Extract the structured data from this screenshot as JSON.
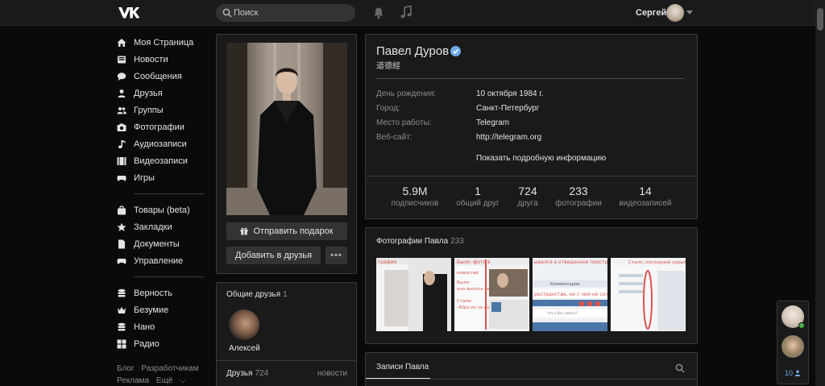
{
  "header": {
    "search_placeholder": "Поиск",
    "user_name": "Сергей"
  },
  "menu": {
    "group1": [
      {
        "label": "Моя Страница",
        "icon": "home-icon"
      },
      {
        "label": "Новости",
        "icon": "news-icon"
      },
      {
        "label": "Сообщения",
        "icon": "messages-icon"
      },
      {
        "label": "Друзья",
        "icon": "friends-icon"
      },
      {
        "label": "Группы",
        "icon": "groups-icon"
      },
      {
        "label": "Фотографии",
        "icon": "camera-icon"
      },
      {
        "label": "Аудиозаписи",
        "icon": "music-icon"
      },
      {
        "label": "Видеозаписи",
        "icon": "video-icon"
      },
      {
        "label": "Игры",
        "icon": "gamepad-icon"
      }
    ],
    "group2": [
      {
        "label": "Товары (beta)",
        "icon": "bag-icon"
      },
      {
        "label": "Закладки",
        "icon": "star-icon"
      },
      {
        "label": "Документы",
        "icon": "document-icon"
      },
      {
        "label": "Управление",
        "icon": "gamepad-icon"
      }
    ],
    "group3": [
      {
        "label": "Верность",
        "icon": "stack-icon"
      },
      {
        "label": "Безумие",
        "icon": "crown-icon"
      },
      {
        "label": "Нано",
        "icon": "stack-icon"
      },
      {
        "label": "Радио",
        "icon": "grid-icon"
      }
    ]
  },
  "footer": {
    "blog": "Блог",
    "developers": "Разработчикам",
    "ads": "Реклама",
    "more": "Ещё"
  },
  "profile": {
    "gift_button": "Отправить подарок",
    "add_friend_button": "Добавить в друзья",
    "name": "Павел Дуров",
    "status": "道德經",
    "fields": [
      {
        "key": "День рождения:",
        "value": "10 октября 1984 г."
      },
      {
        "key": "Город:",
        "value": "Санкт-Петербург"
      },
      {
        "key": "Место работы:",
        "value": "Telegram"
      },
      {
        "key": "Веб-сайт:",
        "value": "http://telegram.org"
      }
    ],
    "more_info": "Показать подробную информацию",
    "counters": [
      {
        "num": "5.9M",
        "cap": "подписчиков"
      },
      {
        "num": "1",
        "cap": "общий друг"
      },
      {
        "num": "724",
        "cap": "друга"
      },
      {
        "num": "233",
        "cap": "фотографии"
      },
      {
        "num": "14",
        "cap": "видеозаписей"
      }
    ]
  },
  "common_friends": {
    "title": "Общие друзья",
    "count": "1",
    "friend_name": "Алексей"
  },
  "friends_block": {
    "title": "Друзья",
    "count": "724",
    "updates": "новости"
  },
  "photos_block": {
    "title": "Фотографии Павла",
    "count": "233",
    "thumb_texts": [
      "графия",
      "Стало: фотография",
      "Было: фото в\nновостей\nБыло:\nоно высота окна\nСтало:\n-42px из за шапки",
      "ывался в отведенное простран\nКомментарии\nространстве, но с чем не сочета",
      "Стало: последний серый"
    ]
  },
  "wall_block": {
    "title": "Записи Павла"
  },
  "chat": {
    "count": "10"
  },
  "colors": {
    "background": "#0a0a0a",
    "panel": "#1a1a1a",
    "border": "#3a3a3a",
    "accent": "#71aaeb",
    "online": "#4bb34b"
  }
}
